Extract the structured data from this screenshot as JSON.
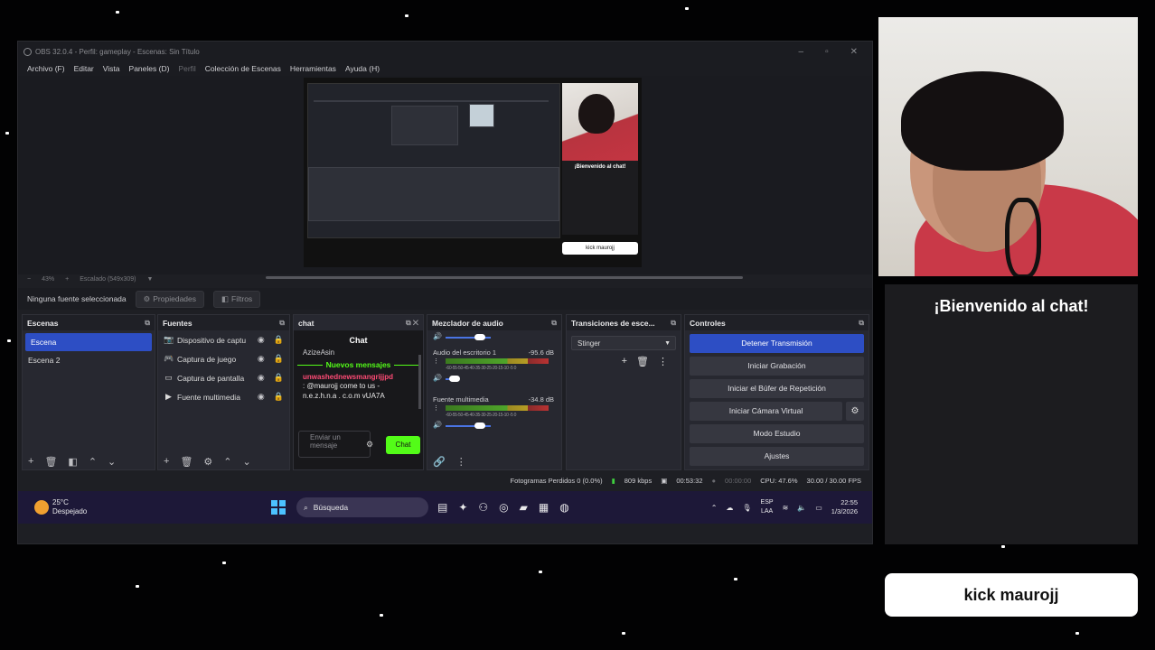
{
  "obs": {
    "title": "OBS 32.0.4 - Perfil: gameplay - Escenas: Sin Título",
    "window_controls": [
      "–",
      "▫",
      "✕"
    ],
    "menu": [
      "Archivo (F)",
      "Editar",
      "Vista",
      "Paneles (D)",
      "Perfil",
      "Colección de Escenas",
      "Herramientas",
      "Ayuda (H)"
    ],
    "zoom": "43%",
    "zoom_mode": "Escalado (549x309)",
    "no_source": "Ninguna fuente seleccionada",
    "properties": "Propiedades",
    "filters": "Filtros",
    "preview": {
      "chat_title": "¡Bienvenido al chat!",
      "kick": "kick maurojj"
    }
  },
  "scenes": {
    "title": "Escenas",
    "items": [
      "Escena",
      "Escena 2"
    ]
  },
  "sources": {
    "title": "Fuentes",
    "items": [
      {
        "label": "Dispositivo de captu",
        "icon": "camera-icon"
      },
      {
        "label": "Captura de juego",
        "icon": "gamepad-icon"
      },
      {
        "label": "Captura de pantalla",
        "icon": "monitor-icon"
      },
      {
        "label": "Fuente multimedia",
        "icon": "play-icon"
      }
    ]
  },
  "chat": {
    "dock_title": "chat",
    "header": "Chat",
    "partial_line": "AzizeAsin",
    "new_messages": "Nuevos mensajes",
    "user": "unwashednewsmangrijjpd",
    "message": ": @maurojj come to us - n.e.z.h.n.a . c.o.m vUA7A",
    "input_placeholder": "Enviar un mensaje",
    "send": "Chat"
  },
  "mixer": {
    "title": "Mezclador de audio",
    "ticks": "-60-55-50-45-40-35-30-25-20-15-10 -5 0",
    "channels": [
      {
        "name": "Audio del escritorio 1",
        "db": "-95.6 dB"
      },
      {
        "name": "Fuente multimedia",
        "db": "-34.8 dB"
      }
    ]
  },
  "transitions": {
    "title": "Transiciones de esce...",
    "selected": "Stinger"
  },
  "controls": {
    "title": "Controles",
    "buttons": [
      "Detener Transmisión",
      "Iniciar Grabación",
      "Iniciar el Búfer de Repetición",
      "Iniciar Cámara Virtual",
      "Modo Estudio",
      "Ajustes"
    ]
  },
  "status": {
    "dropped": "Fotogramas Perdidos 0 (0.0%)",
    "bitrate": "809 kbps",
    "stream_time": "00:53:32",
    "rec_time": "00:00:00",
    "cpu": "CPU: 47.6%",
    "fps": "30.00 / 30.00 FPS"
  },
  "taskbar": {
    "temp": "25°C",
    "weather": "Despejado",
    "search": "Búsqueda",
    "lang1": "ESP",
    "lang2": "LAA",
    "time": "22:55",
    "date": "1/3/2026"
  },
  "overlay": {
    "chat_title": "¡Bienvenido al chat!",
    "kick": "kick maurojj"
  }
}
